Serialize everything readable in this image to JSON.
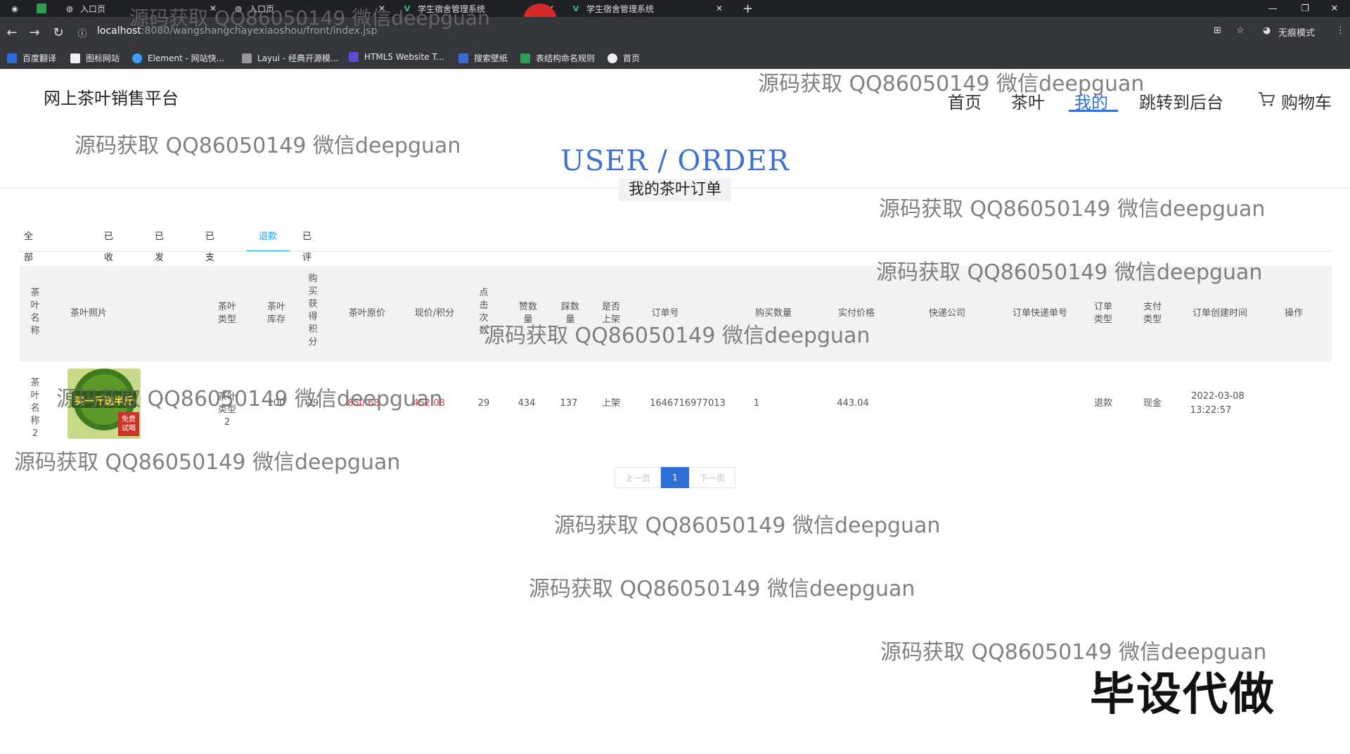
{
  "browser": {
    "tabs": [
      {
        "label": "入口页"
      },
      {
        "label": "入口页"
      },
      {
        "label": "学生宿舍管理系统"
      },
      {
        "label": "学生宿舍管理系统"
      }
    ],
    "url_host": "localhost",
    "url_path": ":8080/wangshangchayexiaoshou/front/index.jsp",
    "incognito_label": "无痕模式",
    "bookmarks": [
      "百度翻译",
      "图标网站",
      "Element - 网站快...",
      "Layui - 经典开源模...",
      "HTML5 Website T...",
      "搜索壁纸",
      "表结构命名规则",
      "首页"
    ]
  },
  "site": {
    "title": "网上茶叶销售平台",
    "nav": [
      "首页",
      "茶叶",
      "我的",
      "跳转到后台",
      "购物车"
    ],
    "active_nav": "我的"
  },
  "hero": {
    "en": "USER / ORDER",
    "cn": "我的茶叶订单"
  },
  "order_tabs": [
    "全部茶叶订单",
    "已收货",
    "已发货",
    "已支付",
    "退款",
    "已评价"
  ],
  "active_tab": "退款",
  "table": {
    "headers": [
      "茶叶名称",
      "茶叶照片",
      "茶叶类型",
      "茶叶库存",
      "购买获得积分",
      "茶叶原价",
      "现价/积分",
      "点击次数",
      "赞数量",
      "踩数量",
      "是否上架",
      "订单号",
      "购买数量",
      "实付价格",
      "快递公司",
      "订单快递单号",
      "订单类型",
      "支付类型",
      "订单创建时间",
      "操作"
    ],
    "rows": [
      {
        "name": "茶叶名称2",
        "type": "茶叶类型2",
        "stock": "100",
        "points": "29",
        "orig_price": "850.68",
        "price": "452.08",
        "clicks": "29",
        "likes": "434",
        "dislikes": "137",
        "on_sale": "上架",
        "order_no": "1646716977013",
        "qty": "1",
        "paid": "443.04",
        "express": "",
        "express_no": "",
        "order_type": "退款",
        "pay_type": "现金",
        "created_date": "2022-03-08",
        "created_time": "13:22:57",
        "thumb_text": "买一斤送半斤",
        "thumb_badge": "免费试喝"
      }
    ]
  },
  "pager": {
    "prev": "上一页",
    "current": "1",
    "next": "下一页"
  },
  "watermark": "源码获取 QQ86050149 微信deepguan",
  "stamp": "毕设代做",
  "colors": {
    "accent": "#2f6fd8",
    "tab_active": "#1e9fff",
    "price_red": "#e04040"
  }
}
